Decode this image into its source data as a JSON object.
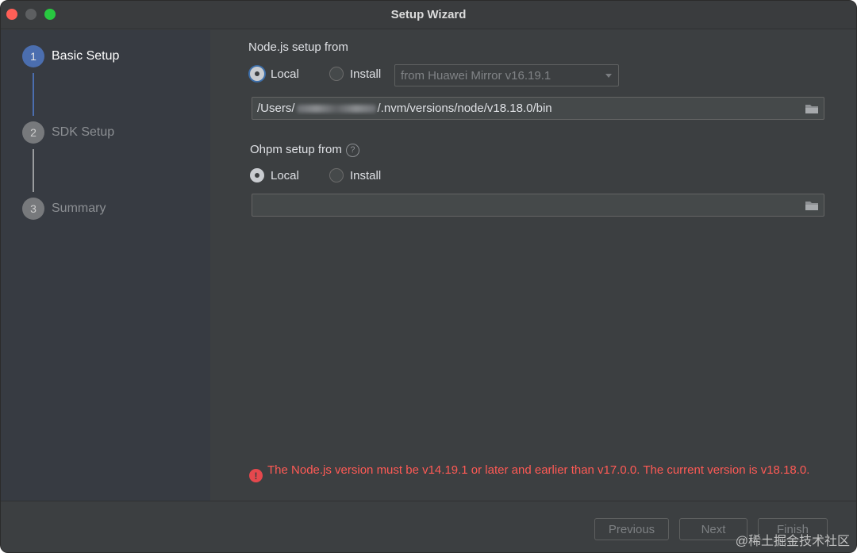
{
  "window": {
    "title": "Setup Wizard"
  },
  "steps": [
    {
      "number": "1",
      "label": "Basic Setup",
      "state": "active"
    },
    {
      "number": "2",
      "label": "SDK Setup",
      "state": "inactive"
    },
    {
      "number": "3",
      "label": "Summary",
      "state": "inactive"
    }
  ],
  "node": {
    "section_label": "Node.js setup from",
    "radio_local": "Local",
    "radio_install": "Install",
    "selected": "Local",
    "mirror_dropdown": "from Huawei Mirror v16.19.1",
    "path_prefix": "/Users/",
    "path_suffix": "/.nvm/versions/node/v18.18.0/bin"
  },
  "ohpm": {
    "section_label": "Ohpm setup from",
    "radio_local": "Local",
    "radio_install": "Install",
    "selected": "Local",
    "path": ""
  },
  "error": {
    "message": "The Node.js version must be v14.19.1 or later and earlier than v17.0.0. The current version is v18.18.0."
  },
  "footer": {
    "previous": "Previous",
    "next": "Next",
    "finish": "Finish"
  },
  "watermark": "@稀土掘金技术社区",
  "colors": {
    "accent": "#4b6eaf",
    "error": "#ff5a55",
    "background": "#3c3f41",
    "sidebar": "#373b42"
  }
}
